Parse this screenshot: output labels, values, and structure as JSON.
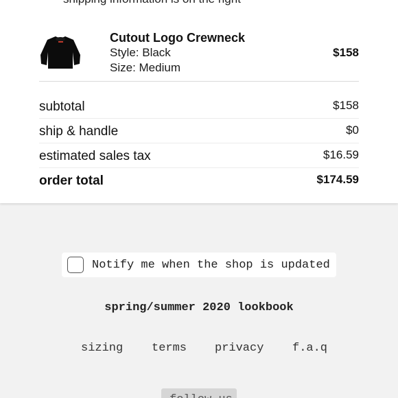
{
  "header": {
    "cut_text": "shipping information is on the right"
  },
  "cart": {
    "item": {
      "name": "Cutout Logo Crewneck",
      "style": "Style: Black",
      "size": "Size: Medium",
      "price": "$158",
      "thumbnail_icon": "crewneck-sweatshirt-image"
    },
    "summary": [
      {
        "label": "subtotal",
        "value": "$158"
      },
      {
        "label": "ship & handle",
        "value": "$0"
      },
      {
        "label": "estimated sales tax",
        "value": "$16.59"
      },
      {
        "label": "order total",
        "value": "$174.59"
      }
    ]
  },
  "notify": {
    "label": "Notify me when the shop is updated",
    "checked": false
  },
  "lookbook": {
    "label": "spring/summer 2020 lookbook"
  },
  "footer": {
    "links": [
      "sizing",
      "terms",
      "privacy",
      "f.a.q"
    ],
    "follow_label": "follow us"
  },
  "colors": {
    "page_bg": "#f2f2f2",
    "card_bg": "#ffffff",
    "button_bg": "#d6d6d6"
  }
}
